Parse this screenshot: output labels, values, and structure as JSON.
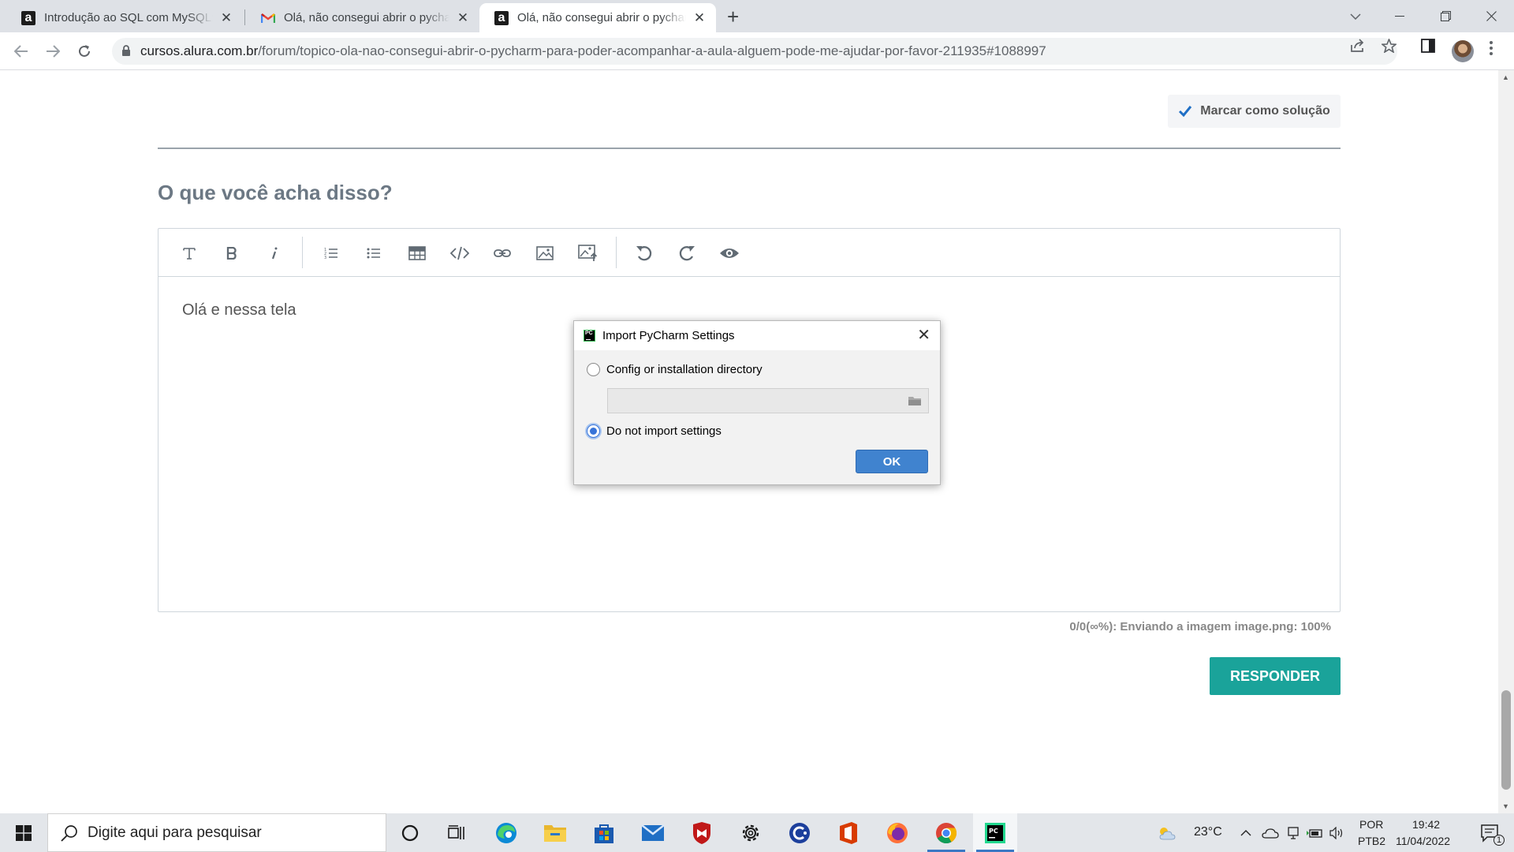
{
  "browser": {
    "tabs": [
      {
        "title": "Introdução ao SQL com MySQL: M",
        "favicon": "alura-icon",
        "active": false
      },
      {
        "title": "Olá, não consegui abrir o pycharm",
        "favicon": "gmail-icon",
        "active": false
      },
      {
        "title": "Olá, não consegui abrir o pycharm",
        "favicon": "alura-icon",
        "active": true
      }
    ],
    "url_host": "cursos.alura.com.br",
    "url_path": "/forum/topico-ola-nao-consegui-abrir-o-pycharm-para-poder-acompanhar-a-aula-alguem-pode-me-ajudar-por-favor-211935#1088997"
  },
  "page": {
    "solution_button": "Marcar como solução",
    "section_title": "O que você acha disso?",
    "editor_text": "Olá e nessa tela",
    "upload_status": "0/0(∞%): Enviando a imagem image.png: 100%",
    "reply_button": "RESPONDER",
    "toolbar_icons": [
      "text-icon",
      "bold-icon",
      "italic-icon",
      "numbered-list-icon",
      "bullet-list-icon",
      "table-icon",
      "code-icon",
      "link-icon",
      "image-icon",
      "image-upload-icon",
      "undo-icon",
      "redo-icon",
      "preview-icon"
    ]
  },
  "dialog": {
    "title": "Import PyCharm Settings",
    "option_config": "Config or installation directory",
    "option_none": "Do not import settings",
    "selected": "option_none",
    "directory_value": "",
    "ok_label": "OK"
  },
  "taskbar": {
    "search_placeholder": "Digite aqui para pesquisar",
    "weather": "23°C",
    "language": "POR",
    "layout": "PTB2",
    "time": "19:42",
    "date": "11/04/2022",
    "notifications": "1"
  },
  "colors": {
    "accent_teal": "#1aa39a",
    "dialog_blue": "#4083cf",
    "heading_gray": "#6c7884"
  }
}
